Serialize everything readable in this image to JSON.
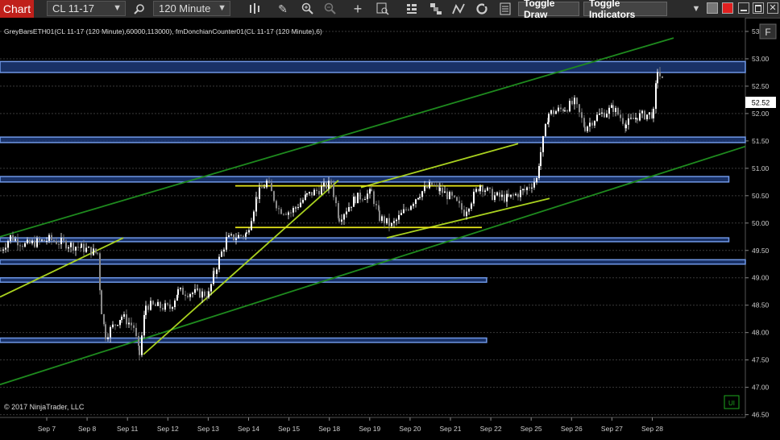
{
  "toolbar": {
    "title": "Chart",
    "instrument": "CL 11-17",
    "interval": "120 Minute",
    "toggle_draw": "Toggle Draw",
    "toggle_indicators": "Toggle Indicators",
    "icons": [
      "magnifier-icon",
      "bars-type-icon",
      "pencil-icon",
      "zoom-in-icon",
      "zoom-out-icon",
      "crosshair-icon",
      "data-box-icon",
      "strategy-icon",
      "indicators-icon",
      "drawing-tools-icon",
      "reload-icon",
      "properties-icon"
    ]
  },
  "chart_info": "GreyBarsETH01(CL 11-17 (120 Minute),60000,113000), fmDonchianCounter01(CL 11-17 (120 Minute),6)",
  "copyright": "© 2017 NinjaTrader, LLC",
  "f_button": "F",
  "colors": {
    "background": "#000000",
    "grid": "#3a3a3a",
    "zone_fill": "#1d3a78",
    "zone_border": "#6f97e6",
    "trend_green": "#1e8a1e",
    "channel_yellowgreen": "#a9d11f",
    "yellow_line": "#e6e61a",
    "candle_up": "#ffffff",
    "candle_down": "#8a8a8a",
    "price_marker": "#ffffff"
  },
  "chart_data": {
    "type": "candlestick",
    "x_tick_labels": [
      "Sep 7",
      "Sep 8",
      "Sep 11",
      "Sep 12",
      "Sep 13",
      "Sep 14",
      "Sep 15",
      "Sep 18",
      "Sep 19",
      "Sep 20",
      "Sep 21",
      "Sep 22",
      "Sep 25",
      "Sep 26",
      "Sep 27",
      "Sep 28"
    ],
    "y_tick_labels": [
      "53.50",
      "53.00",
      "52.50",
      "52.00",
      "51.50",
      "51.00",
      "50.50",
      "50.00",
      "49.50",
      "49.00",
      "48.50",
      "48.00",
      "47.50",
      "47.00",
      "46.50"
    ],
    "ylim": [
      46.45,
      53.75
    ],
    "last_price": "52.52",
    "zones": [
      {
        "y_low": 52.75,
        "y_high": 52.95,
        "x_start": "Sep 7",
        "x_end": "right-edge"
      },
      {
        "y_low": 51.47,
        "y_high": 51.57,
        "x_start": "Sep 7",
        "x_end": "right-edge"
      },
      {
        "y_low": 50.75,
        "y_high": 50.85,
        "x_start": "Sep 7",
        "x_end": "Sep 28"
      },
      {
        "y_low": 49.66,
        "y_high": 49.73,
        "x_start": "Sep 7",
        "x_end": "Sep 28"
      },
      {
        "y_low": 49.25,
        "y_high": 49.33,
        "x_start": "Sep 7",
        "x_end": "right-edge"
      },
      {
        "y_low": 48.92,
        "y_high": 49.0,
        "x_start": "Sep 7",
        "x_end": "Sep 20"
      },
      {
        "y_low": 47.82,
        "y_high": 47.9,
        "x_start": "Sep 7",
        "x_end": "Sep 20"
      }
    ],
    "trend_lines": [
      {
        "color": "green",
        "points": [
          [
            0,
            49.75
          ],
          [
            836,
            53.38
          ]
        ]
      },
      {
        "color": "green",
        "points": [
          [
            0,
            47.05
          ],
          [
            925,
            51.4
          ]
        ]
      },
      {
        "color": "yellowgreen",
        "points": [
          [
            0,
            48.65
          ],
          [
            153,
            49.73
          ]
        ]
      },
      {
        "color": "yellowgreen",
        "points": [
          [
            178,
            47.6
          ],
          [
            420,
            50.78
          ]
        ]
      },
      {
        "color": "yellowgreen",
        "points": [
          [
            480,
            49.73
          ],
          [
            682,
            50.45
          ]
        ]
      },
      {
        "color": "yellowgreen",
        "points": [
          [
            448,
            50.65
          ],
          [
            643,
            51.45
          ]
        ]
      },
      {
        "color": "yellow",
        "points": [
          [
            292,
            50.68
          ],
          [
            600,
            50.68
          ]
        ]
      },
      {
        "color": "yellow",
        "points": [
          [
            292,
            49.92
          ],
          [
            598,
            49.92
          ]
        ]
      }
    ],
    "path_keys": [
      [
        0,
        49.5
      ],
      [
        12,
        49.75
      ],
      [
        30,
        49.6
      ],
      [
        60,
        49.7
      ],
      [
        100,
        49.55
      ],
      [
        120,
        49.45
      ],
      [
        125,
        48.4
      ],
      [
        130,
        47.95
      ],
      [
        150,
        48.3
      ],
      [
        165,
        48.1
      ],
      [
        172,
        47.6
      ],
      [
        180,
        48.5
      ],
      [
        210,
        48.45
      ],
      [
        220,
        48.75
      ],
      [
        258,
        48.7
      ],
      [
        265,
        49.1
      ],
      [
        280,
        49.7
      ],
      [
        305,
        49.8
      ],
      [
        318,
        50.5
      ],
      [
        330,
        50.75
      ],
      [
        345,
        50.25
      ],
      [
        360,
        50.2
      ],
      [
        380,
        50.5
      ],
      [
        410,
        50.72
      ],
      [
        420,
        50.1
      ],
      [
        440,
        50.45
      ],
      [
        460,
        50.55
      ],
      [
        470,
        50.1
      ],
      [
        485,
        49.95
      ],
      [
        500,
        50.2
      ],
      [
        520,
        50.55
      ],
      [
        535,
        50.7
      ],
      [
        545,
        50.6
      ],
      [
        560,
        50.45
      ],
      [
        575,
        50.2
      ],
      [
        595,
        50.7
      ],
      [
        610,
        50.5
      ],
      [
        630,
        50.45
      ],
      [
        650,
        50.6
      ],
      [
        665,
        50.8
      ],
      [
        670,
        51.3
      ],
      [
        680,
        52.0
      ],
      [
        700,
        52.1
      ],
      [
        712,
        52.2
      ],
      [
        725,
        51.75
      ],
      [
        740,
        51.95
      ],
      [
        760,
        52.1
      ],
      [
        776,
        51.8
      ],
      [
        790,
        51.95
      ],
      [
        810,
        52.0
      ],
      [
        815,
        52.8
      ],
      [
        822,
        52.55
      ]
    ]
  }
}
